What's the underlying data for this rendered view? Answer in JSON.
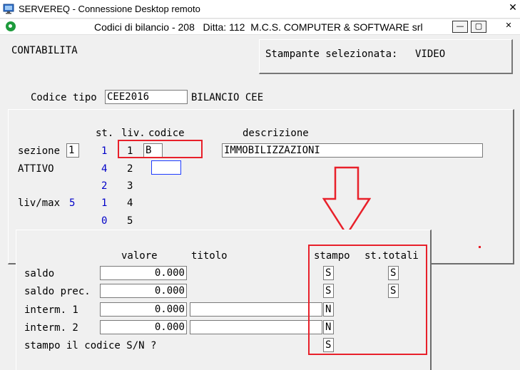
{
  "rdp": {
    "title": "SERVEREQ - Connessione Desktop remoto",
    "close_glyph": "✕",
    "icon": "remote-desktop-icon"
  },
  "app": {
    "title": "Codici di bilancio - 208   Ditta: 112  M.C.S. COMPUTER & SOFTWARE srl",
    "icon": "app-logo-icon",
    "minimize_glyph": "—",
    "restore_glyph": "▢",
    "close_glyph": "✕"
  },
  "header": {
    "module": "CONTABILITA",
    "printer_label": "Stampante selezionata:",
    "printer_value": "VIDEO"
  },
  "codice_tipo": {
    "label": "Codice tipo",
    "value": "CEE2016",
    "description": "BILANCIO CEE"
  },
  "levels": {
    "col_st": "st.",
    "col_liv": "liv.",
    "col_codice": "codice",
    "col_descrizione": "descrizione",
    "sezione_label": "sezione",
    "sezione_value": "1",
    "side_label": "ATTIVO",
    "livmax_label": "liv/max",
    "livmax_value": "5",
    "rows": [
      {
        "st": "1",
        "liv": "1",
        "codice": "B",
        "descrizione": "IMMOBILIZZAZIONI"
      },
      {
        "st": "4",
        "liv": "2",
        "codice": "",
        "descrizione": ""
      },
      {
        "st": "2",
        "liv": "3"
      },
      {
        "st": "1",
        "liv": "4"
      },
      {
        "st": "0",
        "liv": "5"
      }
    ]
  },
  "values": {
    "col_valore": "valore",
    "col_titolo": "titolo",
    "col_stampo": "stampo",
    "col_sttotali": "st.totali",
    "rows": [
      {
        "label": "saldo",
        "valore": "0.000",
        "titolo": null,
        "stampo": "S",
        "sttotali": "S"
      },
      {
        "label": "saldo prec.",
        "valore": "0.000",
        "titolo": null,
        "stampo": "S",
        "sttotali": "S"
      },
      {
        "label": "interm. 1",
        "valore": "0.000",
        "titolo": "",
        "stampo": "N",
        "sttotali": null
      },
      {
        "label": "interm. 2",
        "valore": "0.000",
        "titolo": "",
        "stampo": "N",
        "sttotali": null
      }
    ],
    "stampo_codice_label": "stampo il codice S/N ?",
    "stampo_codice_value": "S"
  },
  "colors": {
    "highlight": "#e8202a",
    "blue_text": "#0000c8",
    "background": "#f0f0f0"
  }
}
